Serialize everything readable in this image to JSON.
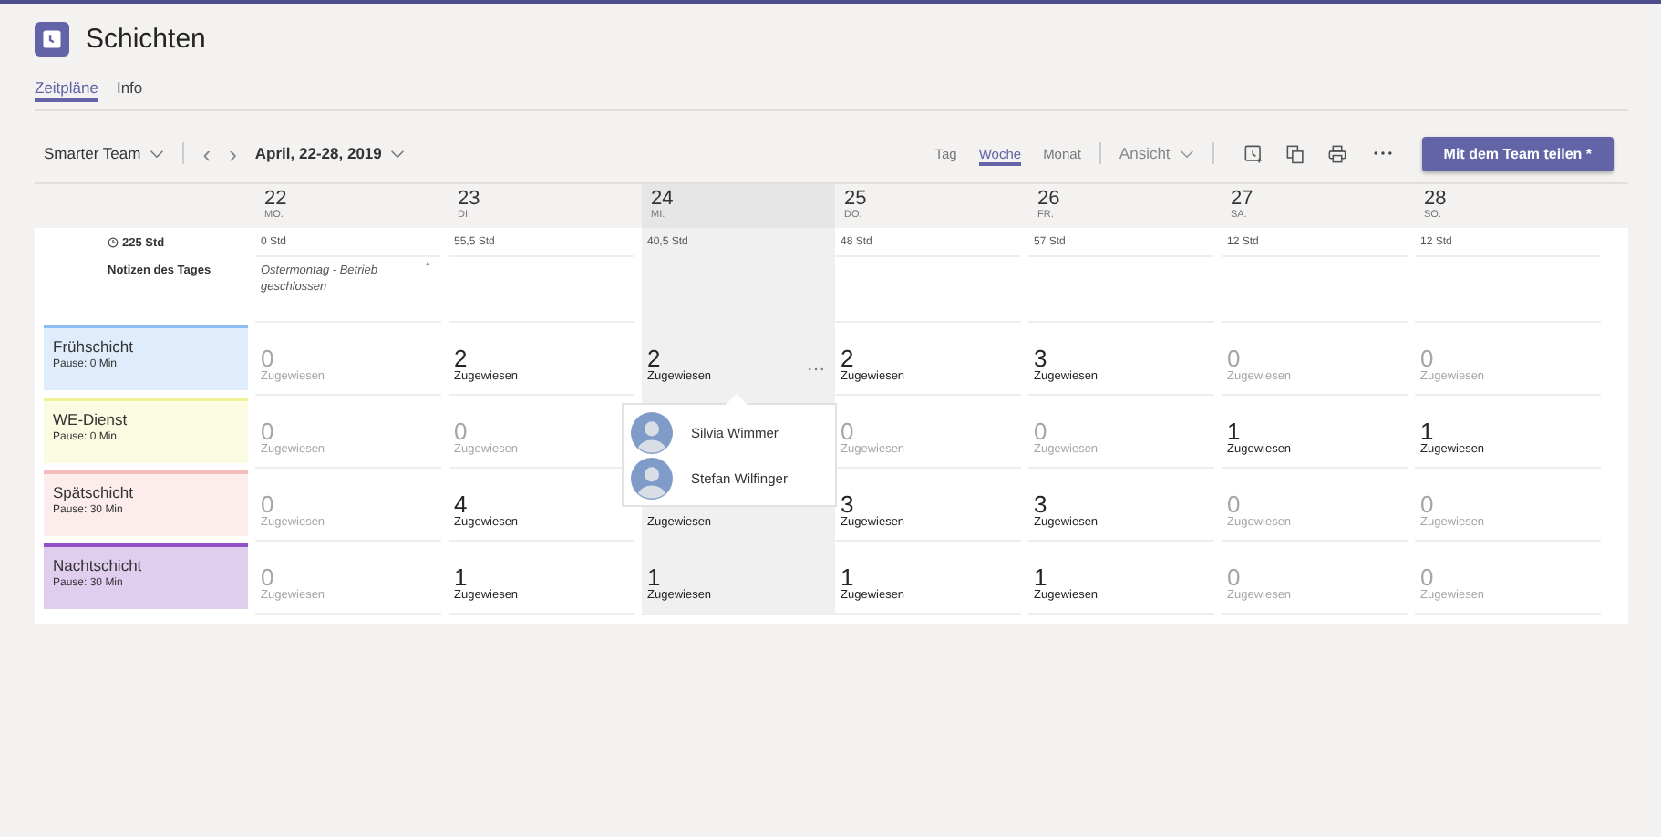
{
  "app": {
    "title": "Schichten"
  },
  "tabs": [
    {
      "label": "Zeitpläne",
      "selected": true
    },
    {
      "label": "Info",
      "selected": false
    }
  ],
  "toolbar": {
    "team": "Smarter Team",
    "prev": "‹",
    "next": "›",
    "date_range": "April, 22-28, 2019",
    "views": [
      {
        "label": "Tag",
        "selected": false
      },
      {
        "label": "Woche",
        "selected": true
      },
      {
        "label": "Monat",
        "selected": false
      }
    ],
    "view_menu": "Ansicht",
    "share_button": "Mit dem Team teilen *"
  },
  "schedule": {
    "total_hours": "225 Std",
    "notes_label": "Notizen des Tages",
    "days": [
      {
        "date": "22",
        "weekday": "MO.",
        "hours": "0 Std",
        "note": "Ostermontag - Betrieb geschlossen",
        "note_mark": "*",
        "highlighted": false
      },
      {
        "date": "23",
        "weekday": "DI.",
        "hours": "55,5 Std",
        "highlighted": false
      },
      {
        "date": "24",
        "weekday": "MI.",
        "hours": "40,5 Std",
        "highlighted": true
      },
      {
        "date": "25",
        "weekday": "DO.",
        "hours": "48 Std",
        "highlighted": false
      },
      {
        "date": "26",
        "weekday": "FR.",
        "hours": "57 Std",
        "highlighted": false
      },
      {
        "date": "27",
        "weekday": "SA.",
        "hours": "12 Std",
        "highlighted": false
      },
      {
        "date": "28",
        "weekday": "SO.",
        "hours": "12 Std",
        "highlighted": false
      }
    ],
    "shifts": [
      {
        "name": "Frühschicht",
        "pause": "Pause: 0 Min",
        "color": "#8cbcf0",
        "cells": [
          {
            "count": "0",
            "label": "Zugewiesen",
            "muted": true
          },
          {
            "count": "2",
            "label": "Zugewiesen",
            "muted": false
          },
          {
            "count": "2",
            "label": "Zugewiesen",
            "muted": false,
            "more": true
          },
          {
            "count": "2",
            "label": "Zugewiesen",
            "muted": false
          },
          {
            "count": "3",
            "label": "Zugewiesen",
            "muted": false
          },
          {
            "count": "0",
            "label": "Zugewiesen",
            "muted": true
          },
          {
            "count": "0",
            "label": "Zugewiesen",
            "muted": true
          }
        ]
      },
      {
        "name": "WE-Dienst",
        "pause": "Pause: 0 Min",
        "color": "#f2f29a",
        "cells": [
          {
            "count": "0",
            "label": "Zugewiesen",
            "muted": true
          },
          {
            "count": "0",
            "label": "Zugewiesen",
            "muted": true
          },
          {},
          {
            "count": "0",
            "label": "Zugewiesen",
            "muted": true
          },
          {
            "count": "0",
            "label": "Zugewiesen",
            "muted": true
          },
          {
            "count": "1",
            "label": "Zugewiesen",
            "muted": false
          },
          {
            "count": "1",
            "label": "Zugewiesen",
            "muted": false
          }
        ]
      },
      {
        "name": "Spätschicht",
        "pause": "Pause: 30 Min",
        "color": "#f5bcbc",
        "cells": [
          {
            "count": "0",
            "label": "Zugewiesen",
            "muted": true
          },
          {
            "count": "4",
            "label": "Zugewiesen",
            "muted": false
          },
          {
            "label": "Zugewiesen",
            "muted": false
          },
          {
            "count": "3",
            "label": "Zugewiesen",
            "muted": false
          },
          {
            "count": "3",
            "label": "Zugewiesen",
            "muted": false
          },
          {
            "count": "0",
            "label": "Zugewiesen",
            "muted": true
          },
          {
            "count": "0",
            "label": "Zugewiesen",
            "muted": true
          }
        ]
      },
      {
        "name": "Nachtschicht",
        "pause": "Pause: 30 Min",
        "color": "#9150c8",
        "cells": [
          {
            "count": "0",
            "label": "Zugewiesen",
            "muted": true
          },
          {
            "count": "1",
            "label": "Zugewiesen",
            "muted": false
          },
          {
            "count": "1",
            "label": "Zugewiesen",
            "muted": false
          },
          {
            "count": "1",
            "label": "Zugewiesen",
            "muted": false
          },
          {
            "count": "1",
            "label": "Zugewiesen",
            "muted": false
          },
          {
            "count": "0",
            "label": "Zugewiesen",
            "muted": true
          },
          {
            "count": "0",
            "label": "Zugewiesen",
            "muted": true
          }
        ]
      }
    ]
  },
  "popup": {
    "people": [
      {
        "name": "Silvia Wimmer"
      },
      {
        "name": "Stefan Wilfinger"
      }
    ]
  }
}
